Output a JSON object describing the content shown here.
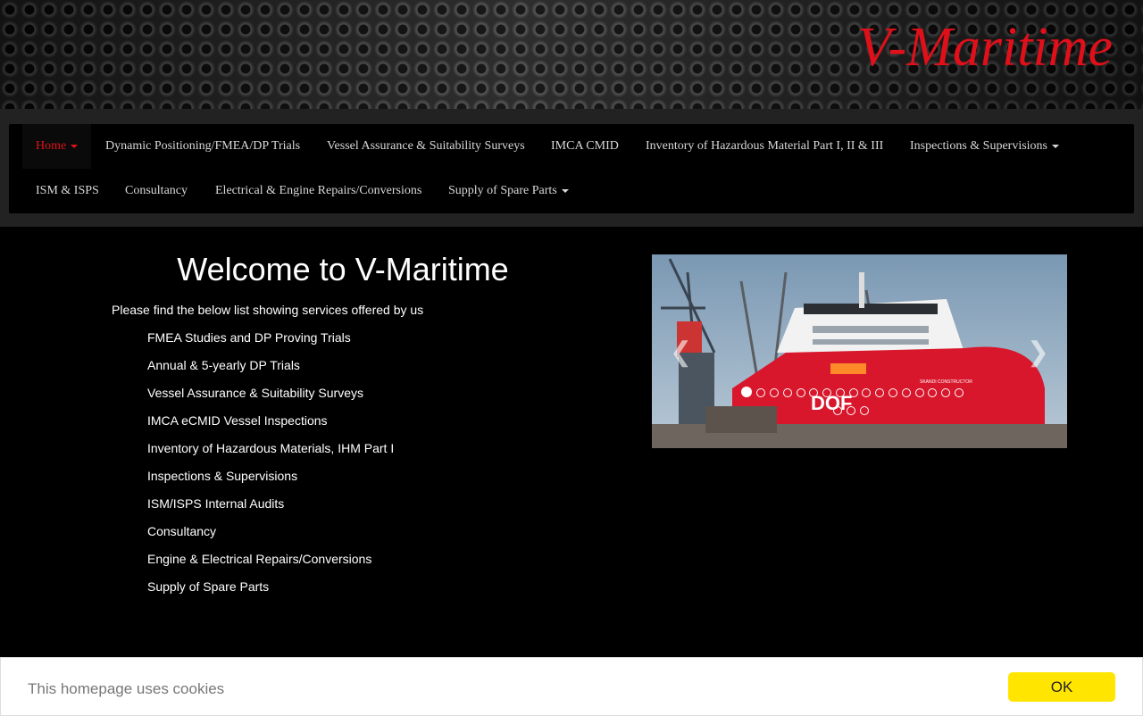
{
  "header": {
    "brand": "V-Maritime"
  },
  "nav": {
    "row1": [
      {
        "label": "Home",
        "dropdown": true,
        "active": true
      },
      {
        "label": "Dynamic Positioning/FMEA/DP Trials"
      },
      {
        "label": "Vessel Assurance & Suitability Surveys"
      },
      {
        "label": "IMCA CMID"
      },
      {
        "label": "Inventory of Hazardous Material Part I, II & III"
      },
      {
        "label": "Inspections & Supervisions",
        "dropdown": true
      }
    ],
    "row2": [
      {
        "label": "ISM & ISPS"
      },
      {
        "label": "Consultancy"
      },
      {
        "label": "Electrical & Engine Repairs/Conversions"
      },
      {
        "label": "Supply of Spare Parts",
        "dropdown": true
      }
    ]
  },
  "main": {
    "title": "Welcome to V-Maritime",
    "intro": "Please find the below list showing services offered by us",
    "services": [
      "FMEA Studies and DP Proving Trials",
      "Annual & 5-yearly DP Trials",
      "Vessel Assurance & Suitability Surveys",
      "IMCA eCMID Vessel Inspections",
      "Inventory of Hazardous Materials, IHM Part I",
      "Inspections & Supervisions",
      "ISM/ISPS Internal Audits",
      "Consultancy",
      "Engine & Electrical Repairs/Conversions",
      "Supply of Spare Parts"
    ]
  },
  "carousel": {
    "prev_icon": "chevron-left-icon",
    "next_icon": "chevron-right-icon",
    "slide_count": 20,
    "active_index": 0,
    "ship_name_text": "SKANDI CONSTRUCTOR",
    "hull_logo": "DOF"
  },
  "cookie": {
    "text": "This homepage uses cookies",
    "ok_label": "OK"
  },
  "colors": {
    "brand_red": "#e0101a",
    "cookie_button": "#ffe500"
  }
}
